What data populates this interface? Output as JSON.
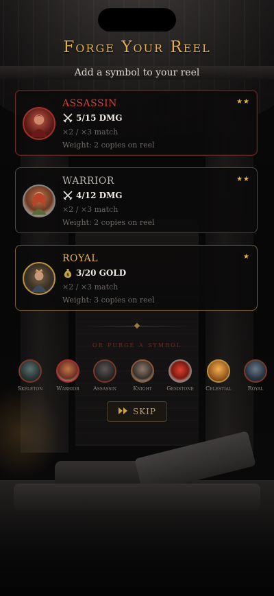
{
  "header": {
    "title": "Forge Your Reel",
    "subtitle": "Add a symbol to your reel"
  },
  "cards": [
    {
      "name": "ASSASSIN",
      "stat_icon": "crossed-swords-icon",
      "stat": "5/15 DMG",
      "match": "×2 / ×3 match",
      "weight": "Weight: 2 copies on reel",
      "stars": "★★",
      "rarity_stars": 2,
      "accent": "#d0403a"
    },
    {
      "name": "WARRIOR",
      "stat_icon": "crossed-swords-icon",
      "stat": "4/12 DMG",
      "match": "×2 / ×3 match",
      "weight": "Weight: 2 copies on reel",
      "stars": "★★",
      "rarity_stars": 2,
      "accent": "#b8b3ae"
    },
    {
      "name": "ROYAL",
      "stat_icon": "money-bag-icon",
      "stat": "3/20 GOLD",
      "match": "×2 / ×3 match",
      "weight": "Weight: 3 copies on reel",
      "stars": "★",
      "rarity_stars": 1,
      "accent": "#e3b24a"
    }
  ],
  "purge": {
    "label": "or purge a symbol",
    "symbols": [
      {
        "label": "Skeleton"
      },
      {
        "label": "Warrior"
      },
      {
        "label": "Assassin"
      },
      {
        "label": "Knight"
      },
      {
        "label": "Gemstone"
      },
      {
        "label": "Celestial"
      },
      {
        "label": "Royal"
      }
    ]
  },
  "skip": {
    "icon": "fast-forward-icon",
    "label": "SKIP"
  },
  "colors": {
    "gold": "#e3b24a",
    "red": "#d0403a",
    "background": "#0b0a0a"
  }
}
